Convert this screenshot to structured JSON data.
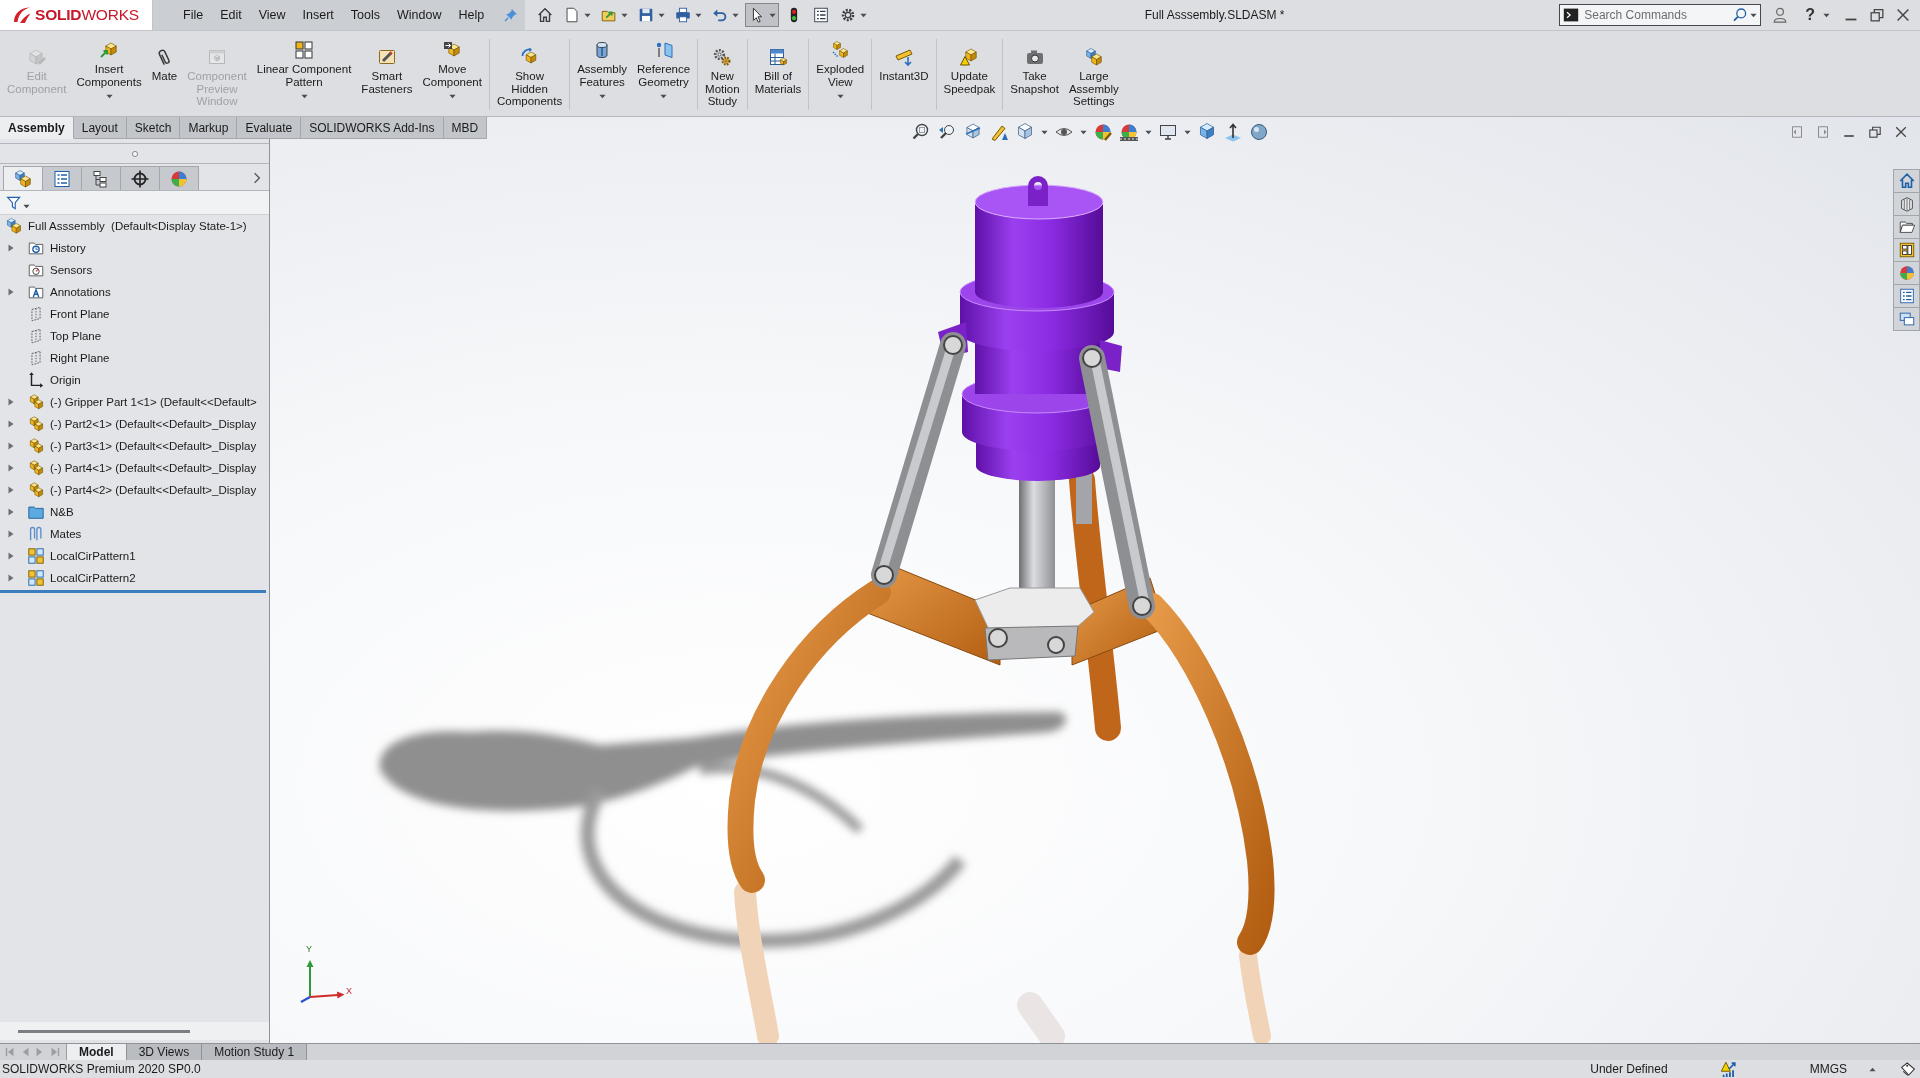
{
  "logo": {
    "text": "**SOLID**WORKS"
  },
  "menu": [
    "File",
    "Edit",
    "View",
    "Insert",
    "Tools",
    "Window",
    "Help"
  ],
  "quick_access": [
    {
      "pressed": false
    },
    {
      "pressed": false
    },
    {
      "pressed": false
    },
    {
      "pressed": false
    },
    {
      "pressed": false
    },
    {
      "pressed": false
    },
    {
      "pressed": true
    },
    {
      "pressed": false
    },
    {
      "pressed": false
    },
    {
      "pressed": false
    }
  ],
  "window": {
    "title": "Full Asssembly.SLDASM *",
    "help": "?"
  },
  "search": {
    "placeholder": "Search Commands"
  },
  "ribbon": {
    "groups": [
      {
        "buttons": [
          {
            "lines": [
              "Edit",
              "Component"
            ],
            "disabled": true,
            "dropdown": false
          },
          {
            "lines": [
              "Insert",
              "Components"
            ],
            "disabled": false,
            "dropdown": true
          },
          {
            "lines": [
              "Mate"
            ],
            "disabled": false,
            "dropdown": false
          },
          {
            "lines": [
              "Component",
              "Preview",
              "Window"
            ],
            "disabled": true,
            "dropdown": false
          },
          {
            "lines": [
              "Linear Component",
              "Pattern"
            ],
            "disabled": false,
            "dropdown": true
          },
          {
            "lines": [
              "Smart",
              "Fasteners"
            ],
            "disabled": false,
            "dropdown": false
          },
          {
            "lines": [
              "Move",
              "Component"
            ],
            "disabled": false,
            "dropdown": true
          }
        ]
      },
      {
        "buttons": [
          {
            "lines": [
              "Show",
              "Hidden",
              "Components"
            ],
            "disabled": false,
            "dropdown": false
          }
        ]
      },
      {
        "buttons": [
          {
            "lines": [
              "Assembly",
              "Features"
            ],
            "disabled": false,
            "dropdown": true
          },
          {
            "lines": [
              "Reference",
              "Geometry"
            ],
            "disabled": false,
            "dropdown": true
          }
        ]
      },
      {
        "buttons": [
          {
            "lines": [
              "New",
              "Motion",
              "Study"
            ],
            "disabled": false,
            "dropdown": false
          }
        ]
      },
      {
        "buttons": [
          {
            "lines": [
              "Bill of",
              "Materials"
            ],
            "disabled": false,
            "dropdown": false
          }
        ]
      },
      {
        "buttons": [
          {
            "lines": [
              "Exploded",
              "View"
            ],
            "disabled": false,
            "dropdown": true
          }
        ]
      },
      {
        "buttons": [
          {
            "lines": [
              "Instant3D"
            ],
            "disabled": false,
            "dropdown": false
          }
        ]
      },
      {
        "buttons": [
          {
            "lines": [
              "Update",
              "Speedpak"
            ],
            "disabled": false,
            "dropdown": false
          }
        ]
      },
      {
        "buttons": [
          {
            "lines": [
              "Take",
              "Snapshot"
            ],
            "disabled": false,
            "dropdown": false
          },
          {
            "lines": [
              "Large",
              "Assembly",
              "Settings"
            ],
            "disabled": false,
            "dropdown": false
          }
        ]
      }
    ]
  },
  "command_tabs": [
    {
      "label": "Assembly",
      "selected": true
    },
    {
      "label": "Layout",
      "selected": false
    },
    {
      "label": "Sketch",
      "selected": false
    },
    {
      "label": "Markup",
      "selected": false
    },
    {
      "label": "Evaluate",
      "selected": false
    },
    {
      "label": "SOLIDWORKS Add-Ins",
      "selected": false
    },
    {
      "label": "MBD",
      "selected": false
    }
  ],
  "feature_manager": {
    "tabs": [
      {
        "selected": true
      },
      {
        "selected": false
      },
      {
        "selected": false
      },
      {
        "selected": false
      },
      {
        "selected": false
      }
    ],
    "tree": {
      "label": "Full Asssembly  (Default<Display State-1>)",
      "selected": false,
      "children": [
        {
          "label": "History",
          "kind": "history",
          "expandable": true,
          "selected": false
        },
        {
          "label": "Sensors",
          "kind": "sensors",
          "expandable": false,
          "selected": false
        },
        {
          "label": "Annotations",
          "kind": "annotations",
          "expandable": true,
          "selected": false
        },
        {
          "label": "Front Plane",
          "kind": "plane",
          "expandable": false,
          "selected": false
        },
        {
          "label": "Top Plane",
          "kind": "plane",
          "expandable": false,
          "selected": false
        },
        {
          "label": "Right Plane",
          "kind": "plane",
          "expandable": false,
          "selected": false
        },
        {
          "label": "Origin",
          "kind": "origin",
          "expandable": false,
          "selected": false
        },
        {
          "label": "(-) Gripper Part 1<1> (Default<<Default>",
          "kind": "part",
          "expandable": true,
          "selected": false
        },
        {
          "label": "(-) Part2<1> (Default<<Default>_Display",
          "kind": "part",
          "expandable": true,
          "selected": false
        },
        {
          "label": "(-) Part3<1> (Default<<Default>_Display",
          "kind": "part",
          "expandable": true,
          "selected": false
        },
        {
          "label": "(-) Part4<1> (Default<<Default>_Display",
          "kind": "part",
          "expandable": true,
          "selected": false
        },
        {
          "label": "(-) Part4<2> (Default<<Default>_Display",
          "kind": "part",
          "expandable": true,
          "selected": false
        },
        {
          "label": "N&B",
          "kind": "folder",
          "expandable": true,
          "selected": false
        },
        {
          "label": "Mates",
          "kind": "mates",
          "expandable": true,
          "selected": false
        },
        {
          "label": "LocalCirPattern1",
          "kind": "pattern",
          "expandable": true,
          "selected": false
        },
        {
          "label": "LocalCirPattern2",
          "kind": "pattern",
          "expandable": true,
          "selected": false
        }
      ]
    }
  },
  "triad": {
    "labels": [
      "Y",
      "X"
    ]
  },
  "bottom_tabs": [
    {
      "label": "Model",
      "selected": true
    },
    {
      "label": "3D Views",
      "selected": false
    },
    {
      "label": "Motion Study 1",
      "selected": false
    }
  ],
  "status_bar": {
    "product": "SOLIDWORKS Premium 2020 SP0.0",
    "state": "Under Defined",
    "units": "MMGS"
  }
}
